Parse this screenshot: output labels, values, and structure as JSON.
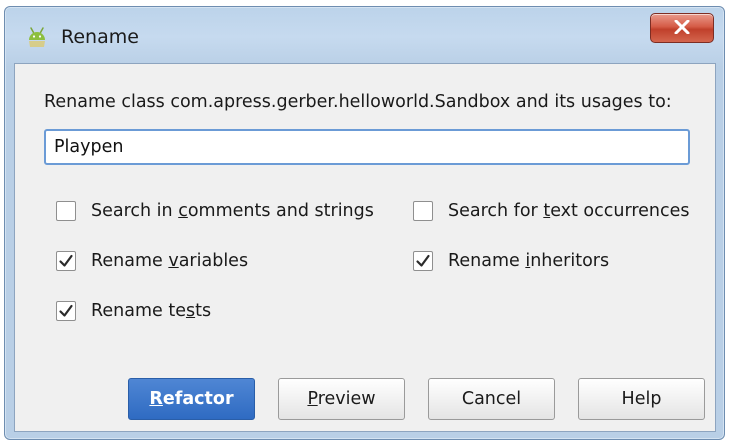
{
  "window": {
    "title": "Rename",
    "app_icon": "android-robot-icon",
    "close_icon": "close-x-icon"
  },
  "dialog": {
    "prompt": "Rename class com.apress.gerber.helloworld.Sandbox and its usages to:",
    "new_name": "Playpen"
  },
  "options": [
    {
      "pre": "Search in ",
      "mnemonic": "c",
      "post": "omments and strings",
      "checked": false
    },
    {
      "pre": "Search for ",
      "mnemonic": "t",
      "post": "ext occurrences",
      "checked": false
    },
    {
      "pre": "Rename ",
      "mnemonic": "v",
      "post": "ariables",
      "checked": true
    },
    {
      "pre": "Rename ",
      "mnemonic": "i",
      "post": "nheritors",
      "checked": true
    },
    {
      "pre": "Rename te",
      "mnemonic": "s",
      "post": "ts",
      "checked": true
    }
  ],
  "buttons": {
    "refactor": {
      "pre": "",
      "mnemonic": "R",
      "post": "efactor"
    },
    "preview": {
      "pre": "",
      "mnemonic": "P",
      "post": "review"
    },
    "cancel": {
      "label": "Cancel"
    },
    "help": {
      "label": "Help"
    }
  },
  "colors": {
    "primary_button": "#3a75c9",
    "input_focus_border": "#6b9bd6",
    "close_button": "#c8462f",
    "title_bar": "#bcd3ea"
  }
}
